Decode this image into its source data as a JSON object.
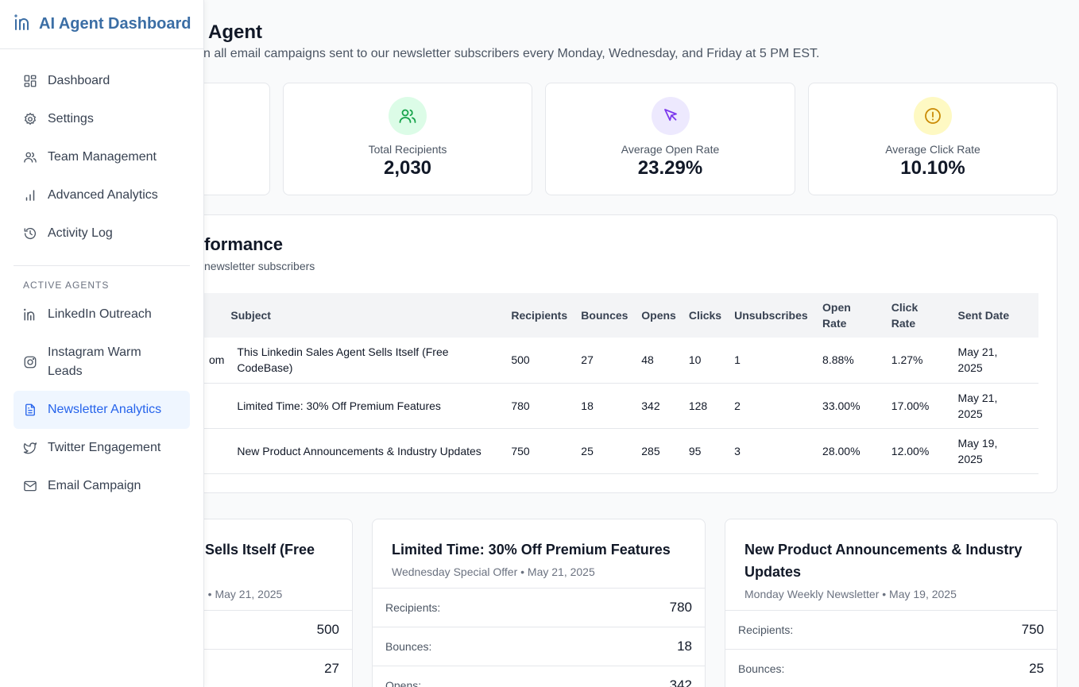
{
  "sidebar": {
    "brand_title": "AI Agent Dashboard",
    "nav": [
      {
        "label": "Dashboard",
        "icon": "dashboard-icon"
      },
      {
        "label": "Settings",
        "icon": "gear-icon"
      },
      {
        "label": "Team Management",
        "icon": "users-icon"
      },
      {
        "label": "Advanced Analytics",
        "icon": "bar-chart-icon"
      },
      {
        "label": "Activity Log",
        "icon": "history-icon"
      }
    ],
    "section_label": "ACTIVE AGENTS",
    "agents": [
      {
        "label": "LinkedIn Outreach",
        "icon": "linkedin-icon"
      },
      {
        "label": "Instagram Warm Leads",
        "icon": "instagram-icon"
      },
      {
        "label": "Newsletter Analytics",
        "icon": "document-icon",
        "active": true
      },
      {
        "label": "Twitter Engagement",
        "icon": "twitter-icon"
      },
      {
        "label": "Email Campaign",
        "icon": "mail-icon"
      }
    ]
  },
  "header": {
    "title_visible": "Agent",
    "description_visible": "n all email campaigns sent to our newsletter subscribers every Monday, Wednesday, and Friday at 5 PM EST."
  },
  "stats": [
    {
      "label": "Total Recipients",
      "value": "2,030",
      "icon": "users-icon",
      "color": "#16a34a",
      "bg": "#dcfce7"
    },
    {
      "label": "Average Open Rate",
      "value": "23.29%",
      "icon": "cursor-icon",
      "color": "#7c3aed",
      "bg": "#ede9fe"
    },
    {
      "label": "Average Click Rate",
      "value": "10.10%",
      "icon": "alert-icon",
      "color": "#ca8a04",
      "bg": "#fef9c3"
    }
  ],
  "performance": {
    "title_visible": "formance",
    "subtitle_visible": "newsletter subscribers",
    "columns": [
      "Subject",
      "Recipients",
      "Bounces",
      "Opens",
      "Clicks",
      "Unsubscribes",
      "Open Rate",
      "Click Rate",
      "Sent Date"
    ],
    "rows": [
      {
        "from_fragment": "om",
        "subject": "This Linkedin Sales Agent Sells Itself (Free CodeBase)",
        "recipients": "500",
        "bounces": "27",
        "opens": "48",
        "clicks": "10",
        "unsubscribes": "1",
        "open_rate": "8.88%",
        "click_rate": "1.27%",
        "sent_date": "May 21, 2025"
      },
      {
        "from_fragment": "",
        "subject": "Limited Time: 30% Off Premium Features",
        "recipients": "780",
        "bounces": "18",
        "opens": "342",
        "clicks": "128",
        "unsubscribes": "2",
        "open_rate": "33.00%",
        "click_rate": "17.00%",
        "sent_date": "May 21, 2025"
      },
      {
        "from_fragment": "",
        "subject": "New Product Announcements & Industry Updates",
        "recipients": "750",
        "bounces": "25",
        "opens": "285",
        "clicks": "95",
        "unsubscribes": "3",
        "open_rate": "28.00%",
        "click_rate": "12.00%",
        "sent_date": "May 19, 2025"
      }
    ]
  },
  "campaigns": [
    {
      "title": "Sells Itself (Free",
      "meta": "n • May 21, 2025",
      "recipients_label": "",
      "recipients": "500",
      "bounces_label": "",
      "bounces": "27"
    },
    {
      "title": "Limited Time: 30% Off Premium Features",
      "meta": "Wednesday Special Offer • May 21, 2025",
      "recipients_label": "Recipients:",
      "recipients": "780",
      "bounces_label": "Bounces:",
      "bounces": "18",
      "opens_label": "Opens:",
      "opens": "342"
    },
    {
      "title": "New Product Announcements & Industry Updates",
      "meta": "Monday Weekly Newsletter • May 19, 2025",
      "recipients_label": "Recipients:",
      "recipients": "750",
      "bounces_label": "Bounces:",
      "bounces": "25"
    }
  ],
  "colors": {
    "accent": "#2563eb",
    "brand": "#3b6ea5",
    "active_bg": "#eff6ff"
  }
}
